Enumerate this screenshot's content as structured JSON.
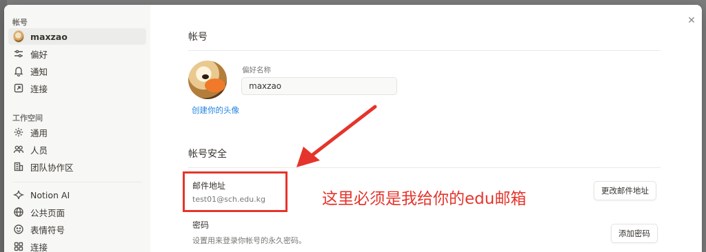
{
  "sidebar": {
    "account_section": "帐号",
    "account_items": [
      {
        "label": "maxzao",
        "icon": "avatar"
      },
      {
        "label": "偏好",
        "icon": "sliders-icon"
      },
      {
        "label": "通知",
        "icon": "bell-icon"
      },
      {
        "label": "连接",
        "icon": "external-link-icon"
      }
    ],
    "workspace_section": "工作空间",
    "workspace_items": [
      {
        "label": "通用",
        "icon": "gear-icon"
      },
      {
        "label": "人员",
        "icon": "people-icon"
      },
      {
        "label": "团队协作区",
        "icon": "building-icon"
      },
      {
        "label": "Notion AI",
        "icon": "sparkle-icon"
      },
      {
        "label": "公共页面",
        "icon": "globe-icon"
      },
      {
        "label": "表情符号",
        "icon": "smiley-icon"
      },
      {
        "label": "连接",
        "icon": "grid-icon"
      }
    ]
  },
  "main": {
    "account_heading": "帐号",
    "preferred_name_label": "偏好名称",
    "preferred_name_value": "maxzao",
    "create_avatar_link": "创建你的头像",
    "security_heading": "帐号安全",
    "email": {
      "title": "邮件地址",
      "value": "test01@sch.edu.kg",
      "button": "更改邮件地址"
    },
    "password": {
      "title": "密码",
      "description": "设置用来登录你帐号的永久密码。",
      "button": "添加密码"
    }
  },
  "annotation": {
    "text": "这里必须是我给你的edu邮箱",
    "color": "#e5342b"
  },
  "close_icon": "close-icon"
}
